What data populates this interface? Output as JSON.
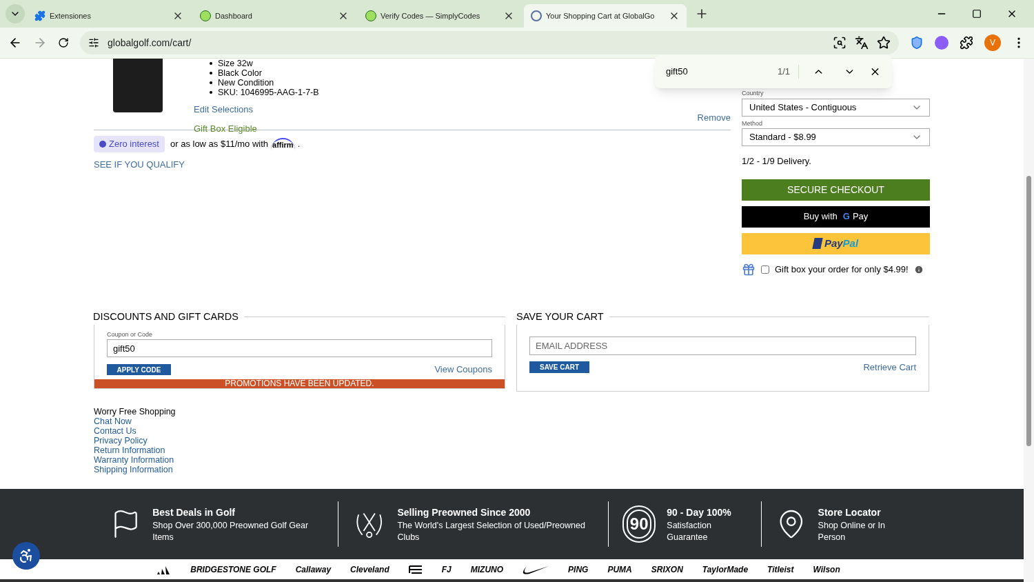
{
  "browser": {
    "tabs": [
      {
        "title": "Extensiones",
        "selected": false,
        "kind": "extension"
      },
      {
        "title": "Dashboard",
        "selected": false,
        "kind": "codes"
      },
      {
        "title": "Verify Codes — SimplyCodes",
        "selected": false,
        "kind": "codes"
      },
      {
        "title": "Your Shopping Cart at GlobalGo",
        "selected": true,
        "kind": "golf"
      }
    ],
    "url": "globalgolf.com/cart/",
    "avatar": "V"
  },
  "find_bar": {
    "query": "gift50",
    "count": "1/1"
  },
  "item": {
    "details": [
      "Size 32w",
      "Black Color",
      "New Condition",
      "SKU: 1046995-AAG-1-7-B"
    ],
    "edit": "Edit Selections",
    "gift_box": "Gift Box Eligible",
    "remove": "Remove"
  },
  "financing": {
    "badge": "Zero interest",
    "text": "or as low as $11/mo with",
    "brand": "affirm",
    "end": ".",
    "qualify": "SEE IF YOU QUALIFY"
  },
  "shipping": {
    "country_label": "Country",
    "country": "United States - Contiguous",
    "method_label": "Method",
    "method": "Standard - $8.99",
    "delivery": "1/2 - 1/9 Delivery."
  },
  "checkout": {
    "secure": "SECURE CHECKOUT",
    "gpay_prefix": "Buy with",
    "gpay_g": "G",
    "gpay": "Pay",
    "paypal_a": "Pay",
    "paypal_b": "Pal"
  },
  "gift_option": {
    "label": "Gift box your order for only $4.99!",
    "checked": false
  },
  "discounts": {
    "title": "DISCOUNTS AND GIFT CARDS",
    "label": "Coupon or Code",
    "value": "gift50",
    "apply": "APPLY CODE",
    "view": "View Coupons",
    "message": "PROMOTIONS HAVE BEEN UPDATED."
  },
  "save_cart": {
    "title": "SAVE YOUR CART",
    "placeholder": "EMAIL ADDRESS",
    "save": "SAVE CART",
    "retrieve": "Retrieve Cart"
  },
  "links": {
    "heading": "Worry Free Shopping",
    "items": [
      "Chat Now",
      "Contact Us",
      "Privacy Policy",
      "Return Information",
      "Warranty Information",
      "Shipping Information"
    ]
  },
  "features": [
    {
      "kind": "flag",
      "title": "Best Deals in Golf",
      "text": "Shop Over 300,000 Preowned Golf Gear Items"
    },
    {
      "kind": "clubs",
      "title": "Selling Preowned Since 2000",
      "text": "The World's Largest Selection of Used/Preowned Clubs"
    },
    {
      "kind": "ninety",
      "title": "90 - Day 100%",
      "text": "Satisfaction Guarantee",
      "badge": "90"
    },
    {
      "kind": "pin",
      "title": "Store Locator",
      "text": "Shop Online or In Person"
    }
  ],
  "brands": [
    {
      "kind": "stripes"
    },
    {
      "kind": "text",
      "name": "BRIDGESTONE GOLF"
    },
    {
      "kind": "text",
      "name": "Callaway"
    },
    {
      "kind": "text",
      "name": "Cleveland"
    },
    {
      "kind": "cobra"
    },
    {
      "kind": "text",
      "name": "FJ"
    },
    {
      "kind": "text",
      "name": "MIZUNO"
    },
    {
      "kind": "swoosh"
    },
    {
      "kind": "text",
      "name": "PING"
    },
    {
      "kind": "text",
      "name": "PUMA"
    },
    {
      "kind": "text",
      "name": "SRIXON"
    },
    {
      "kind": "text",
      "name": "TaylorMade"
    },
    {
      "kind": "text",
      "name": "Titleist"
    },
    {
      "kind": "text",
      "name": "Wilson"
    }
  ]
}
